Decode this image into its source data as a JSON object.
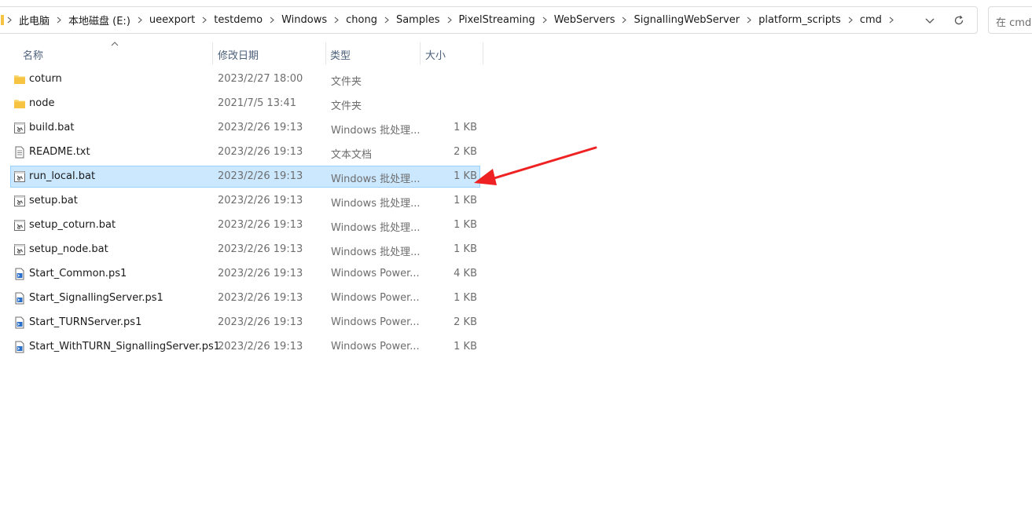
{
  "breadcrumb": [
    "此电脑",
    "本地磁盘 (E:)",
    "ueexport",
    "testdemo",
    "Windows",
    "chong",
    "Samples",
    "PixelStreaming",
    "WebServers",
    "SignallingWebServer",
    "platform_scripts",
    "cmd"
  ],
  "search": {
    "placeholder": "在 cmd"
  },
  "columns": {
    "name": "名称",
    "date": "修改日期",
    "type": "类型",
    "size": "大小"
  },
  "files": [
    {
      "name": "coturn",
      "date": "2023/2/27 18:00",
      "type": "文件夹",
      "size": "",
      "icon": "folder-icon"
    },
    {
      "name": "node",
      "date": "2021/7/5 13:41",
      "type": "文件夹",
      "size": "",
      "icon": "folder-icon"
    },
    {
      "name": "build.bat",
      "date": "2023/2/26 19:13",
      "type": "Windows 批处理...",
      "size": "1 KB",
      "icon": "batch-file-icon"
    },
    {
      "name": "README.txt",
      "date": "2023/2/26 19:13",
      "type": "文本文档",
      "size": "2 KB",
      "icon": "text-file-icon"
    },
    {
      "name": "run_local.bat",
      "date": "2023/2/26 19:13",
      "type": "Windows 批处理...",
      "size": "1 KB",
      "icon": "batch-file-icon",
      "selected": true
    },
    {
      "name": "setup.bat",
      "date": "2023/2/26 19:13",
      "type": "Windows 批处理...",
      "size": "1 KB",
      "icon": "batch-file-icon"
    },
    {
      "name": "setup_coturn.bat",
      "date": "2023/2/26 19:13",
      "type": "Windows 批处理...",
      "size": "1 KB",
      "icon": "batch-file-icon"
    },
    {
      "name": "setup_node.bat",
      "date": "2023/2/26 19:13",
      "type": "Windows 批处理...",
      "size": "1 KB",
      "icon": "batch-file-icon"
    },
    {
      "name": "Start_Common.ps1",
      "date": "2023/2/26 19:13",
      "type": "Windows Power...",
      "size": "4 KB",
      "icon": "powershell-file-icon"
    },
    {
      "name": "Start_SignallingServer.ps1",
      "date": "2023/2/26 19:13",
      "type": "Windows Power...",
      "size": "1 KB",
      "icon": "powershell-file-icon"
    },
    {
      "name": "Start_TURNServer.ps1",
      "date": "2023/2/26 19:13",
      "type": "Windows Power...",
      "size": "2 KB",
      "icon": "powershell-file-icon"
    },
    {
      "name": "Start_WithTURN_SignallingServer.ps1",
      "date": "2023/2/26 19:13",
      "type": "Windows Power...",
      "size": "1 KB",
      "icon": "powershell-file-icon"
    }
  ],
  "colors": {
    "selection": "#cce8ff",
    "selection_border": "#99d1ff",
    "annotation_arrow": "#ee2222",
    "folder": "#f6c343"
  }
}
